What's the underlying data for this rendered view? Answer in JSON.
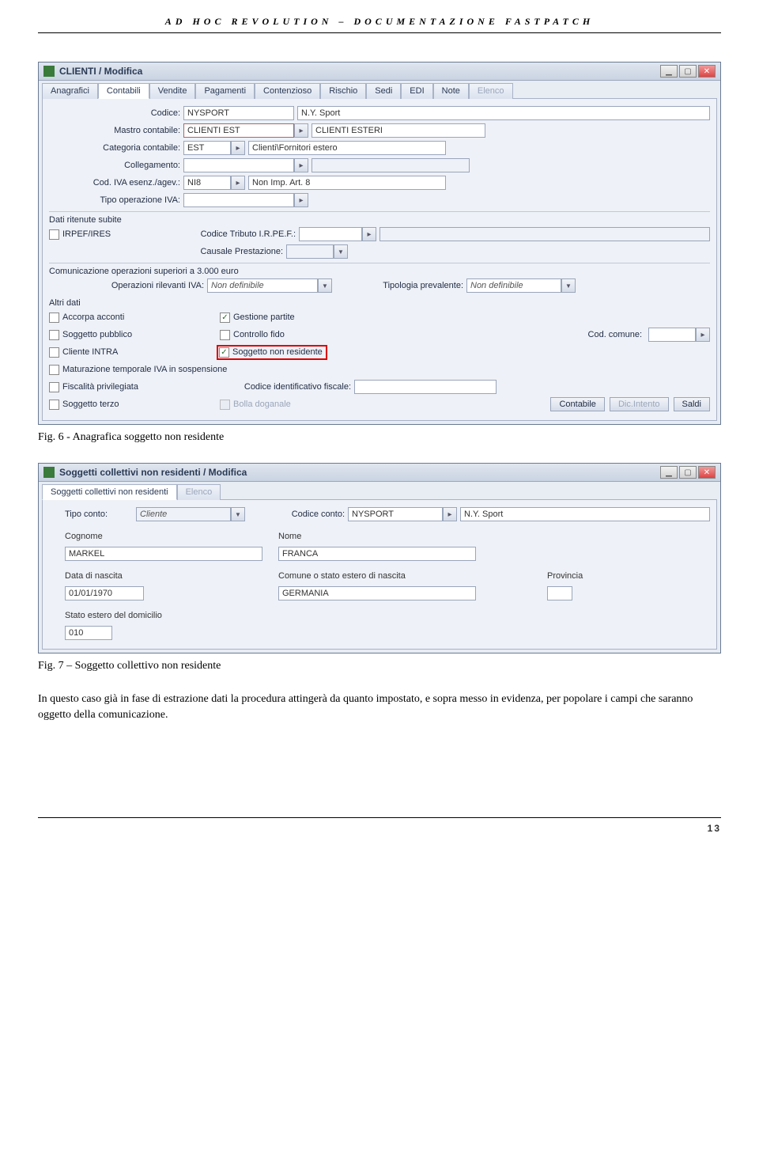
{
  "doc": {
    "header": "AD HOC REVOLUTION – DOCUMENTAZIONE FASTPATCH",
    "fig6": "Fig. 6 - Anagrafica soggetto non residente",
    "fig7": "Fig. 7 – Soggetto collettivo non residente",
    "body": "In questo caso già in fase di estrazione dati la procedura attingerà da quanto impostato, e sopra messo in evidenza, per popolare i campi che saranno oggetto della comunicazione.",
    "page": "13"
  },
  "win1": {
    "title": "CLIENTI / Modifica",
    "tabs": [
      "Anagrafici",
      "Contabili",
      "Vendite",
      "Pagamenti",
      "Contenzioso",
      "Rischio",
      "Sedi",
      "EDI",
      "Note",
      "Elenco"
    ],
    "labels": {
      "codice": "Codice:",
      "mastro": "Mastro contabile:",
      "categoria": "Categoria contabile:",
      "collegamento": "Collegamento:",
      "codiva": "Cod. IVA esenz./agev.:",
      "tipoop": "Tipo operazione IVA:",
      "ritenute_hdr": "Dati ritenute subite",
      "irpef": "IRPEF/IRES",
      "codtrib": "Codice Tributo I.R.PE.F.:",
      "causale": "Causale Prestazione:",
      "com3000_hdr": "Comunicazione operazioni superiori a 3.000 euro",
      "oprilevanti": "Operazioni rilevanti IVA:",
      "tipoprev": "Tipologia prevalente:",
      "altri_hdr": "Altri dati",
      "accorpa": "Accorpa acconti",
      "gestione": "Gestione partite",
      "soggpub": "Soggetto pubblico",
      "fido": "Controllo fido",
      "codcomune": "Cod. comune:",
      "clienteintra": "Cliente INTRA",
      "soggnonres": "Soggetto non residente",
      "maturazione": "Maturazione temporale IVA in sospensione",
      "fiscpriv": "Fiscalità privilegiata",
      "codidfisc": "Codice identificativo fiscale:",
      "soggterzo": "Soggetto terzo",
      "bolla": "Bolla doganale"
    },
    "values": {
      "codice": "NYSPORT",
      "codice_desc": "N.Y. Sport",
      "mastro": "CLIENTI EST",
      "mastro_desc": "CLIENTI ESTERI",
      "categoria": "EST",
      "categoria_desc": "Clienti\\Fornitori estero",
      "collegamento": "",
      "codiva": "NI8",
      "codiva_desc": "Non Imp. Art. 8",
      "tipoop": "",
      "codtrib": "",
      "causale": "",
      "oprilevanti": "Non definibile",
      "tipoprev": "Non definibile",
      "codcomune": "",
      "codidfisc": ""
    },
    "checks": {
      "irpef": false,
      "accorpa": false,
      "gestione": true,
      "soggpub": false,
      "fido": false,
      "clienteintra": false,
      "soggnonres": true,
      "maturazione": false,
      "fiscpriv": false,
      "soggterzo": false,
      "bolla": false
    },
    "buttons": {
      "contabile": "Contabile",
      "dicintento": "Dic.Intento",
      "saldi": "Saldi"
    }
  },
  "win2": {
    "title": "Soggetti collettivi non residenti / Modifica",
    "tabs": [
      "Soggetti collettivi non residenti",
      "Elenco"
    ],
    "labels": {
      "tipoconto": "Tipo conto:",
      "codiceconto": "Codice conto:",
      "cognome": "Cognome",
      "nome": "Nome",
      "datanascita": "Data di nascita",
      "comunenascita": "Comune o stato estero di nascita",
      "provincia": "Provincia",
      "statoestero": "Stato estero del domicilio"
    },
    "values": {
      "tipoconto": "Cliente",
      "codiceconto": "NYSPORT",
      "codiceconto_desc": "N.Y. Sport",
      "cognome": "MARKEL",
      "nome": "FRANCA",
      "datanascita": "01/01/1970",
      "comunenascita": "GERMANIA",
      "provincia": "",
      "statoestero": "010"
    }
  }
}
